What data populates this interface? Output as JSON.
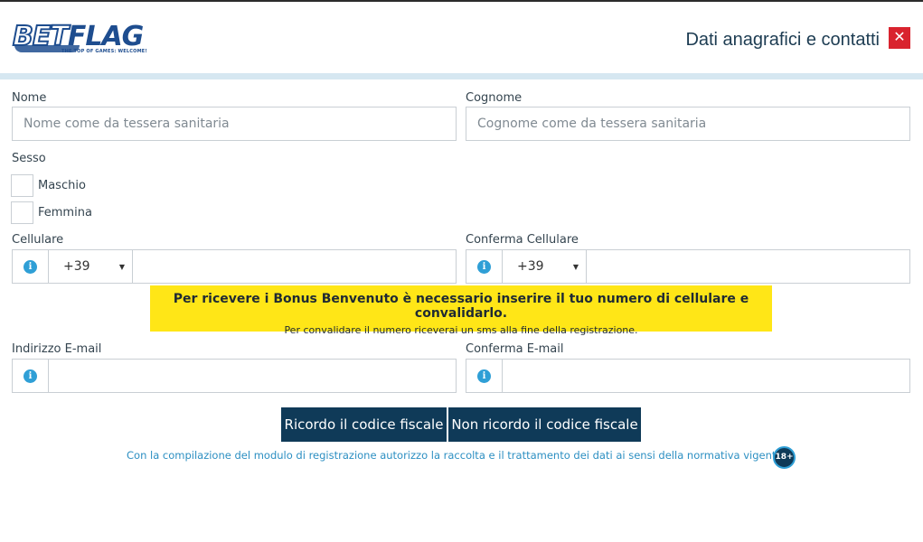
{
  "header": {
    "logo_text_a": "BET",
    "logo_text_b": "FLAG",
    "logo_tagline": "THE TOP OF GAMES: WELCOME!",
    "title": "Dati anagrafici e contatti",
    "close_glyph": "✕",
    "accent_color": "#d6e7f1"
  },
  "form": {
    "nome": {
      "label": "Nome",
      "placeholder": "Nome come da tessera sanitaria",
      "value": ""
    },
    "cognome": {
      "label": "Cognome",
      "placeholder": "Cognome come da tessera sanitaria",
      "value": ""
    },
    "sesso": {
      "label": "Sesso",
      "options": [
        "Maschio",
        "Femmina"
      ]
    },
    "cellulare": {
      "label": "Cellulare",
      "prefix": "+39",
      "value": ""
    },
    "conferma_cellulare": {
      "label": "Conferma Cellulare",
      "prefix": "+39",
      "value": ""
    },
    "notice": {
      "main": "Per ricevere i Bonus Benvenuto è necessario inserire il tuo numero di cellulare e convalidarlo.",
      "sub": "Per convalidare il numero riceverai un sms alla fine della registrazione.",
      "color": "#ffe617"
    },
    "email": {
      "label": "Indirizzo E-mail",
      "value": ""
    },
    "conferma_email": {
      "label": "Conferma E-mail",
      "value": ""
    }
  },
  "actions": {
    "remember_cf": "Ricordo il codice fiscale",
    "not_remember_cf": "Non ricordo il codice fiscale",
    "button_color": "#0f3a58"
  },
  "footer": {
    "disclaimer": "Con la compilazione del modulo di registrazione autorizzo la raccolta e il trattamento dei dati ai sensi della normativa vigente.",
    "age_badge": "18+"
  },
  "icons": {
    "info": "i",
    "caret": "▼"
  }
}
